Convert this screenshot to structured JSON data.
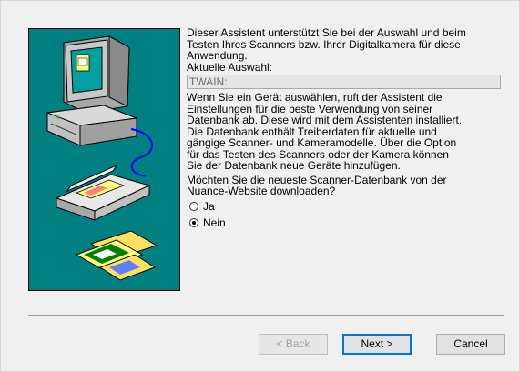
{
  "intro": "Dieser Assistent unterstützt Sie bei der Auswahl und beim\nTesten Ihres Scanners bzw. Ihrer Digitalkamera für diese\nAnwendung.",
  "selection_label": "Aktuelle Auswahl:",
  "selection_value": "TWAIN:",
  "info": "Wenn Sie ein Gerät auswählen, ruft der Assistent die\nEinstellungen für die beste Verwendung von seiner\nDatenbank ab. Diese wird mit dem Assistenten installiert.\nDie Datenbank enthält Treiberdaten für aktuelle und\ngängige Scanner- und Kameramodelle.  Über die Option\nfür das Testen des Scanners oder der Kamera können\nSie der Datenbank neue Geräte hinzufügen.",
  "question": "Möchten Sie die neueste Scanner-Datenbank von der\nNuance-Website downloaden?",
  "options": [
    {
      "label": "Ja",
      "selected": false
    },
    {
      "label": "Nein",
      "selected": true
    }
  ],
  "buttons": {
    "back": "< Back",
    "next": "Next >",
    "cancel": "Cancel"
  },
  "colors": {
    "panel_bg": "#008080",
    "dialog_bg": "#f0f0f0"
  },
  "icons": [
    "computer-icon",
    "scanner-icon",
    "photos-icon"
  ]
}
